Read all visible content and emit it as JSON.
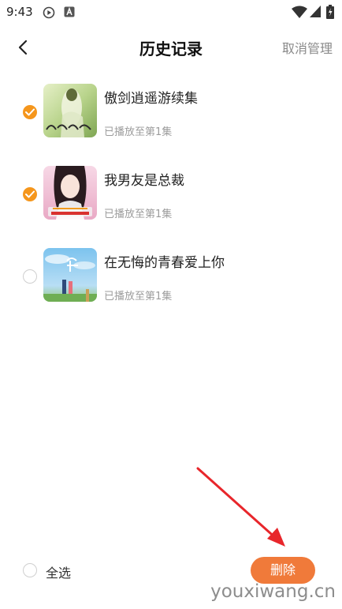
{
  "status_bar": {
    "time": "9:43",
    "icons": [
      "play-circle-icon",
      "a-square-icon",
      "wifi-icon",
      "signal-icon",
      "battery-icon"
    ]
  },
  "header": {
    "title": "历史记录",
    "back_icon": "chevron-left-icon",
    "right_action": "取消管理"
  },
  "items": [
    {
      "title": "傲剑逍遥游续集",
      "progress": "已播放至第1集",
      "checked": true
    },
    {
      "title": "我男友是总裁",
      "progress": "已播放至第1集",
      "checked": true
    },
    {
      "title": "在无悔的青春爱上你",
      "progress": "已播放至第1集",
      "checked": false
    }
  ],
  "footer": {
    "select_all_label": "全选",
    "delete_label": "删除"
  },
  "colors": {
    "accent": "#f5961c",
    "delete_button": "#f07a3a",
    "annotation_arrow": "#e8262b"
  },
  "watermark": "youxiwang.cn"
}
